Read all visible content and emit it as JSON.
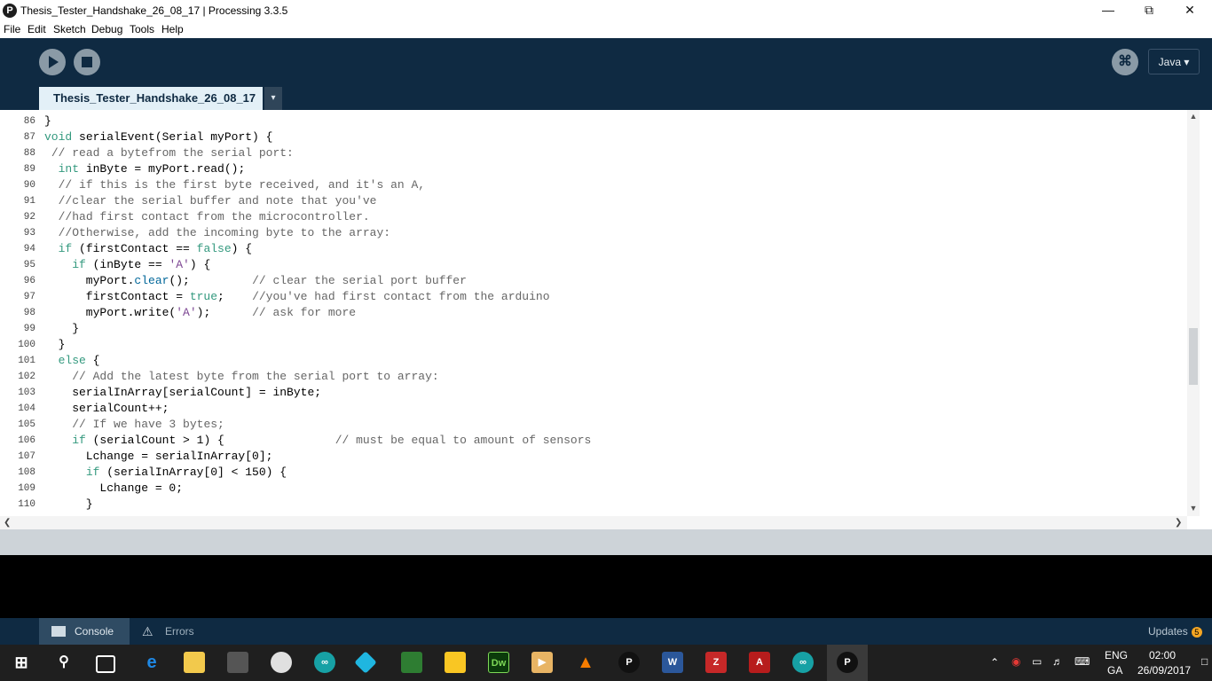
{
  "window": {
    "title": "Thesis_Tester_Handshake_26_08_17 | Processing 3.3.5",
    "app_icon": "processing-icon",
    "controls": [
      "minimize",
      "maximize",
      "close"
    ]
  },
  "menu": [
    "File",
    "Edit",
    "Sketch",
    "Debug",
    "Tools",
    "Help"
  ],
  "toolbar": {
    "mode_label": "Java ▾",
    "debug_icon": "debug-icon"
  },
  "tab": {
    "label": "Thesis_Tester_Handshake_26_08_17",
    "menu_arrow": "▾"
  },
  "code_lines": [
    {
      "n": "86",
      "text": "}"
    },
    {
      "n": "87",
      "text": "void serialEvent(Serial myPort) {"
    },
    {
      "n": "88",
      "text": " // read a bytefrom the serial port:"
    },
    {
      "n": "89",
      "text": "  int inByte = myPort.read();"
    },
    {
      "n": "90",
      "text": "  // if this is the first byte received, and it's an A,"
    },
    {
      "n": "91",
      "text": "  //clear the serial buffer and note that you've"
    },
    {
      "n": "92",
      "text": "  //had first contact from the microcontroller."
    },
    {
      "n": "93",
      "text": "  //Otherwise, add the incoming byte to the array:"
    },
    {
      "n": "94",
      "text": "  if (firstContact == false) {"
    },
    {
      "n": "95",
      "text": "    if (inByte == 'A') {"
    },
    {
      "n": "96",
      "text": "      myPort.clear();         // clear the serial port buffer"
    },
    {
      "n": "97",
      "text": "      firstContact = true;    //you've had first contact from the arduino"
    },
    {
      "n": "98",
      "text": "      myPort.write('A');      // ask for more"
    },
    {
      "n": "99",
      "text": "    }"
    },
    {
      "n": "100",
      "text": "  }"
    },
    {
      "n": "101",
      "text": "  else {"
    },
    {
      "n": "102",
      "text": "    // Add the latest byte from the serial port to array:"
    },
    {
      "n": "103",
      "text": "    serialInArray[serialCount] = inByte;"
    },
    {
      "n": "104",
      "text": "    serialCount++;"
    },
    {
      "n": "105",
      "text": "    // If we have 3 bytes;"
    },
    {
      "n": "106",
      "text": "    if (serialCount > 1) {                // must be equal to amount of sensors"
    },
    {
      "n": "107",
      "text": "      Lchange = serialInArray[0];"
    },
    {
      "n": "108",
      "text": "      if (serialInArray[0] < 150) {"
    },
    {
      "n": "109",
      "text": "        Lchange = 0;"
    },
    {
      "n": "110",
      "text": "      }"
    }
  ],
  "console_tabs": {
    "console": "Console",
    "errors": "Errors"
  },
  "updates": {
    "label": "Updates",
    "count": "5"
  },
  "taskbar": {
    "apps": [
      "start",
      "search",
      "task-view",
      "edge",
      "file-explorer",
      "store",
      "chrome",
      "arduino",
      "kodi",
      "android-file",
      "keep",
      "dreamweaver",
      "media-player",
      "vlc",
      "processing",
      "word",
      "filezilla",
      "acrobat",
      "arduino-2",
      "processing-active"
    ],
    "lang_top": "ENG",
    "lang_bottom": "GA",
    "time": "02:00",
    "date": "26/09/2017"
  }
}
